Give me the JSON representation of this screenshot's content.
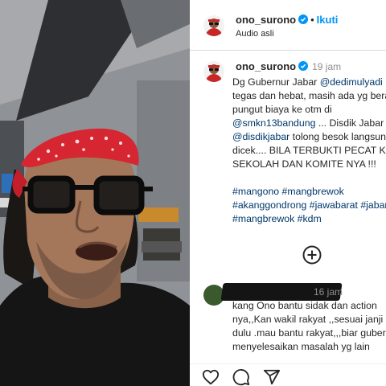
{
  "header": {
    "username": "ono_surono",
    "follow_label": "Ikuti",
    "separator": "•",
    "audio_label": "Audio asli"
  },
  "post": {
    "username": "ono_surono",
    "time": "19 jam",
    "caption": {
      "l1_text": "Dg Gubernur Jabar ",
      "l1_mention": "@dedimulyadi",
      "l2": "tegas dan hebat, masih ada yg berani",
      "l3": "pungut biaya ke otm di",
      "l4_mention": "@smkn13bandung",
      "l4_text": " ... Disdik Jabar",
      "l5_mention": "@disdikjabar",
      "l5_text": " tolong besok langsung",
      "l6": "dicek.... BILA TERBUKTI PECAT KEPALA",
      "l7": "SEKOLAH DAN KOMITE NYA !!!"
    },
    "hashtags": {
      "l1a": "#mangono",
      "l1b": "#mangbrewok",
      "l2a": "#akanggondrong",
      "l2b": "#jawabarat",
      "l2c": "#jabar",
      "l3a": "#mangbrewok",
      "l3b": "#kdm"
    }
  },
  "comment": {
    "time": "16 jam",
    "l1": "kang Ono bantu sidak dan action",
    "l2": "nya,,Kan wakil rakyat ,,sesuai janji",
    "l3": "dulu .mau bantu rakyat,,,biar gubernur",
    "l4": "menyelesaikan masalah yg lain"
  },
  "icons": {
    "verified": "verified-badge-icon",
    "load_more": "plus-circle-icon",
    "like": "heart-icon",
    "comment": "comment-icon",
    "share": "send-icon"
  },
  "colors": {
    "accent": "#0095f6",
    "link": "#00376b",
    "text": "#262626",
    "muted": "#8e8e8e",
    "bandana": "#d62632"
  }
}
